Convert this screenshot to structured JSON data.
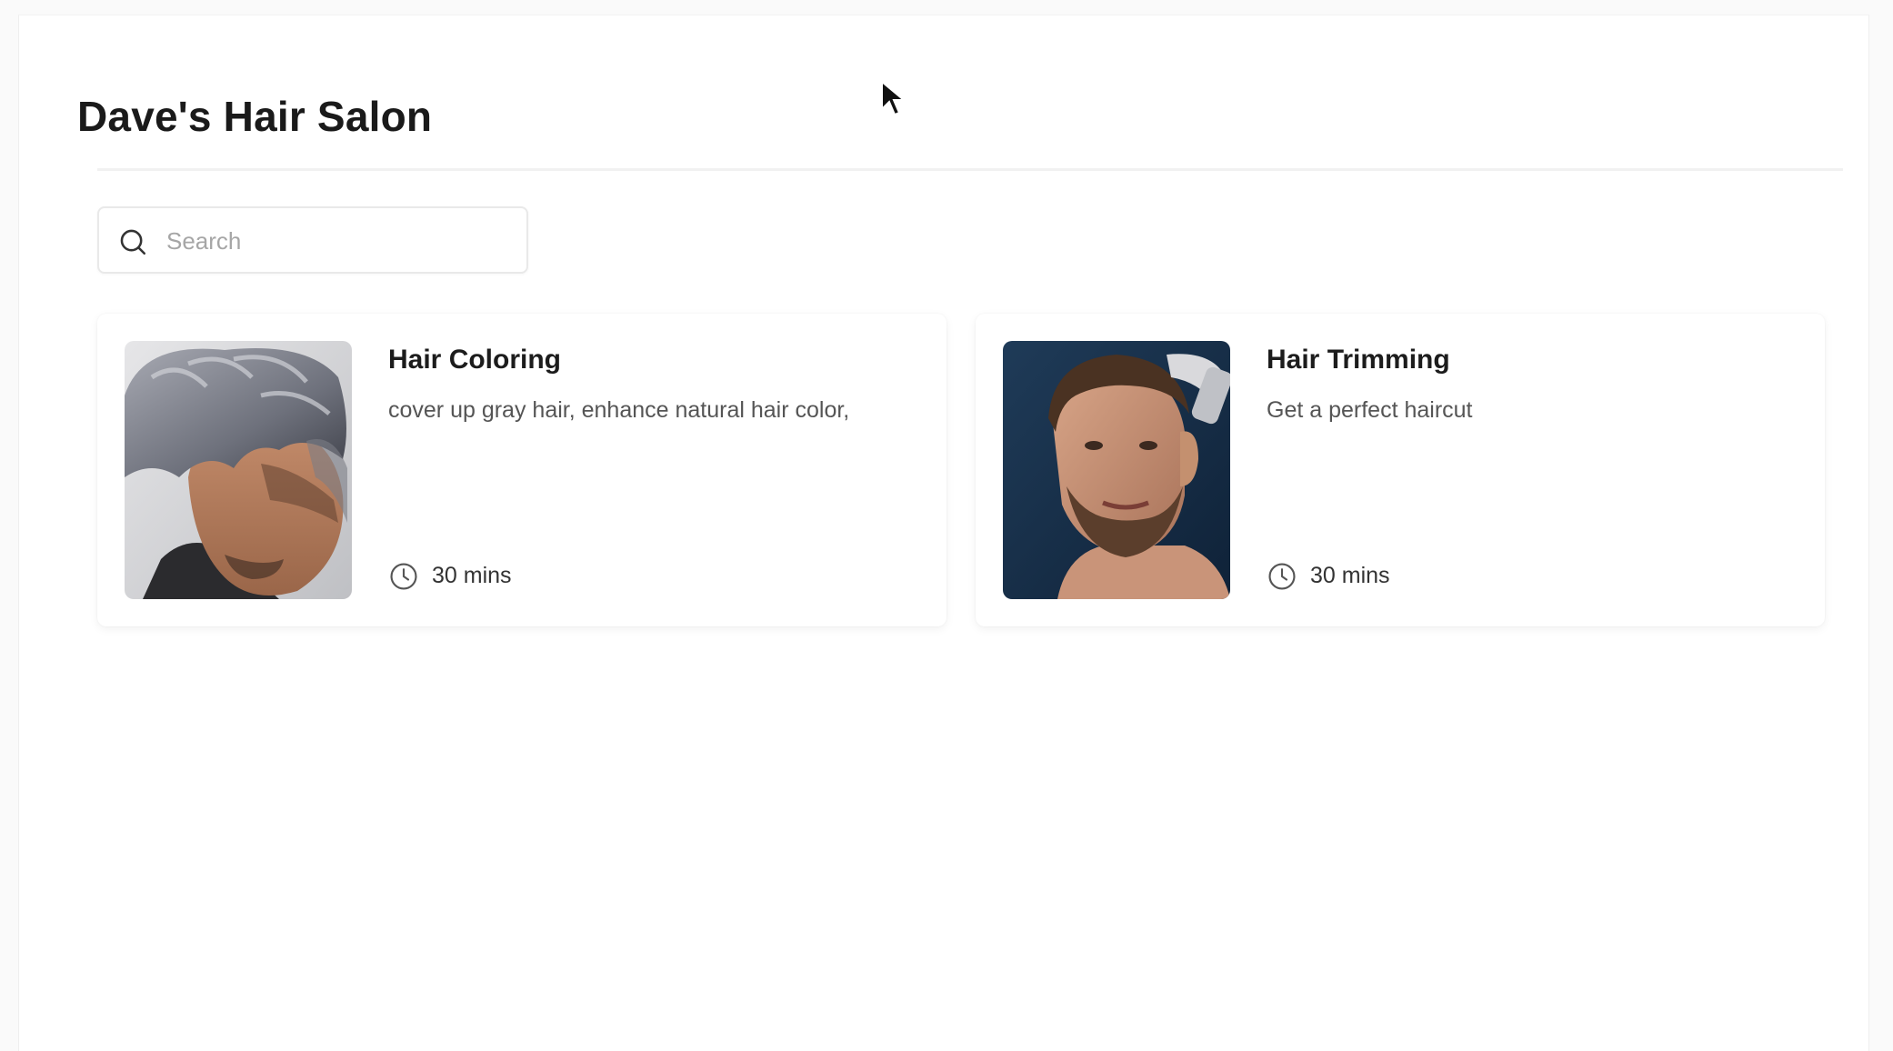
{
  "header": {
    "title": "Dave's Hair Salon"
  },
  "search": {
    "placeholder": "Search",
    "icon": "search-icon"
  },
  "services": [
    {
      "title": "Hair Coloring",
      "description": "cover up gray hair, enhance natural hair color,",
      "duration": "30 mins",
      "image": "photo of man with silver-gray styled hair"
    },
    {
      "title": "Hair Trimming",
      "description": "Get a perfect haircut",
      "duration": "30 mins",
      "image": "photo of bearded man getting a haircut with clippers"
    }
  ],
  "colors": {
    "background": "#ffffff",
    "text": "#1c1c1c",
    "muted": "#555555",
    "placeholder": "#a6a6a6",
    "border": "#e9e9e9"
  }
}
